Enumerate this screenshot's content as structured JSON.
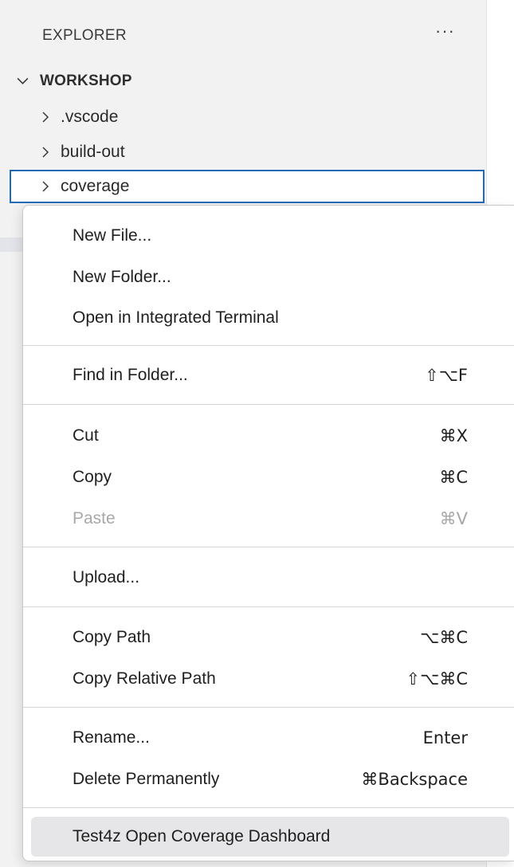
{
  "explorer": {
    "title": "EXPLORER",
    "more_icon": "ellipsis-icon",
    "more_label": "···",
    "workspace": {
      "label": "WORKSHOP",
      "icon": "chevron-down-icon",
      "expanded": true
    },
    "items": [
      {
        "label": ".vscode",
        "icon": "chevron-right-icon",
        "selected": false
      },
      {
        "label": "build-out",
        "icon": "chevron-right-icon",
        "selected": false
      },
      {
        "label": "coverage",
        "icon": "chevron-right-icon",
        "selected": true
      }
    ]
  },
  "context_menu": {
    "groups": [
      {
        "items": [
          {
            "label": "New File...",
            "shortcut": ""
          },
          {
            "label": "New Folder...",
            "shortcut": ""
          },
          {
            "label": "Open in Integrated Terminal",
            "shortcut": ""
          }
        ]
      },
      {
        "items": [
          {
            "label": "Find in Folder...",
            "shortcut": "⇧⌥F"
          }
        ]
      },
      {
        "items": [
          {
            "label": "Cut",
            "shortcut": "⌘X"
          },
          {
            "label": "Copy",
            "shortcut": "⌘C"
          },
          {
            "label": "Paste",
            "shortcut": "⌘V",
            "disabled": true
          }
        ]
      },
      {
        "items": [
          {
            "label": "Upload...",
            "shortcut": ""
          }
        ]
      },
      {
        "items": [
          {
            "label": "Copy Path",
            "shortcut": "⌥⌘C"
          },
          {
            "label": "Copy Relative Path",
            "shortcut": "⇧⌥⌘C"
          }
        ]
      },
      {
        "items": [
          {
            "label": "Rename...",
            "shortcut": "Enter"
          },
          {
            "label": "Delete Permanently",
            "shortcut": "⌘Backspace"
          }
        ]
      },
      {
        "items": [
          {
            "label": "Test4z Open Coverage Dashboard",
            "shortcut": "",
            "highlighted": true
          }
        ]
      }
    ]
  },
  "colors": {
    "sidebar_background": "#f2f2f3",
    "selection_border": "#1f6bb8",
    "menu_highlight": "#e6e6e8",
    "disabled_text": "#a8a8a8"
  }
}
